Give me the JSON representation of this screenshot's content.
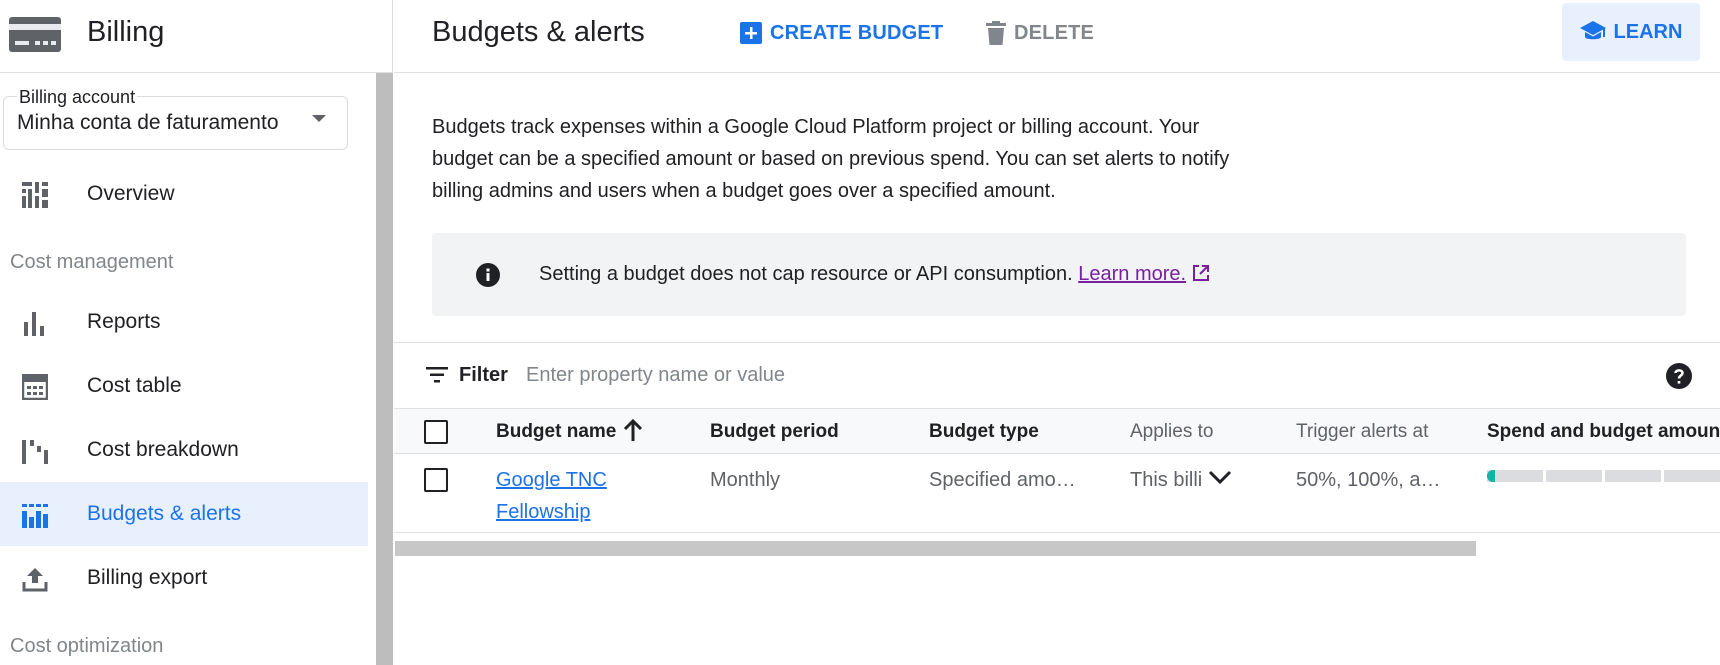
{
  "sidebar": {
    "title": "Billing",
    "billing_account": {
      "label": "Billing account",
      "value": "Minha conta de faturamento"
    },
    "items": [
      {
        "label": "Overview",
        "icon": "overview-icon"
      },
      {
        "label": "Reports",
        "icon": "bar-chart-icon"
      },
      {
        "label": "Cost table",
        "icon": "calculator-icon"
      },
      {
        "label": "Cost breakdown",
        "icon": "breakdown-icon"
      },
      {
        "label": "Budgets & alerts",
        "icon": "budgets-icon",
        "active": true
      },
      {
        "label": "Billing export",
        "icon": "upload-icon"
      }
    ],
    "sections": {
      "cost_management": "Cost management",
      "cost_optimization": "Cost optimization"
    }
  },
  "header": {
    "title": "Budgets & alerts",
    "create_label": "CREATE BUDGET",
    "delete_label": "DELETE",
    "learn_label": "LEARN"
  },
  "description": "Budgets track expenses within a Google Cloud Platform project or billing account. Your budget can be a specified amount or based on previous spend. You can set alerts to notify billing admins and users when a budget goes over a specified amount.",
  "info": {
    "text": "Setting a budget does not cap resource or API consumption.",
    "link": "Learn more."
  },
  "filter": {
    "label": "Filter",
    "placeholder": "Enter property name or value"
  },
  "table": {
    "columns": [
      "Budget name",
      "Budget period",
      "Budget type",
      "Applies to",
      "Trigger alerts at",
      "Spend and budget amount"
    ],
    "rows": [
      {
        "name": "Google TNC Fellowship",
        "period": "Monthly",
        "type": "Specified amo…",
        "applies": "This billi",
        "triggers": "50%, 100%, a…",
        "spend_fraction": 0.03
      }
    ]
  },
  "colors": {
    "accent": "#1a73e8",
    "active_bg": "#e8f0fe",
    "spend_fill": "#12b5a5",
    "link_visited": "#7b1fa2"
  }
}
